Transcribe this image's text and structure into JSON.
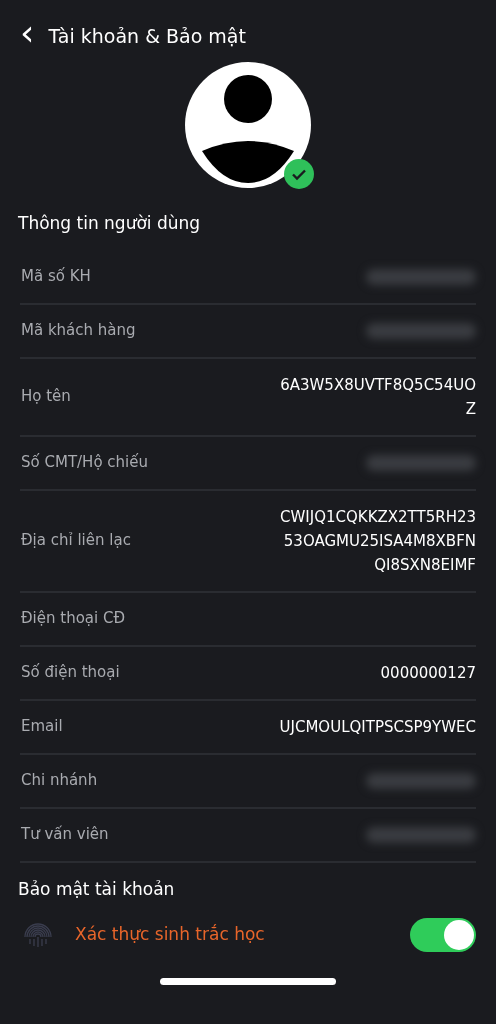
{
  "header": {
    "back": "‹",
    "title": "Tài khoản & Bảo mật"
  },
  "avatar": {
    "verified": true
  },
  "user_info": {
    "title": "Thông tin người dùng",
    "rows": [
      {
        "label": "Mã số KH",
        "masked": true
      },
      {
        "label": "Mã khách hàng",
        "masked": true
      },
      {
        "label": "Họ tên",
        "value": "6A3W5X8UVTF8Q5C54UOZ",
        "masked": false
      },
      {
        "label": "Số CMT/Hộ chiếu",
        "masked": true
      },
      {
        "label": "Địa chỉ liên lạc",
        "value": "CWIJQ1CQKKZX2TT5RH2353OAGMU25ISA4M8XBFNQI8SXN8EIMF",
        "masked": false
      },
      {
        "label": "Điện thoại CĐ",
        "masked": false
      },
      {
        "label": "Số điện thoại",
        "value": "0000000127",
        "masked": false
      },
      {
        "label": "Email",
        "value": "UJCMOULQITPSCSP9YWEC",
        "masked": false
      },
      {
        "label": "Chi nhánh",
        "masked": true
      },
      {
        "label": "Tư vấn viên",
        "masked": true
      }
    ]
  },
  "security": {
    "title": "Bảo mật tài khoản",
    "items": [
      {
        "label": "Xác thực sinh trắc học",
        "on": true
      }
    ]
  }
}
